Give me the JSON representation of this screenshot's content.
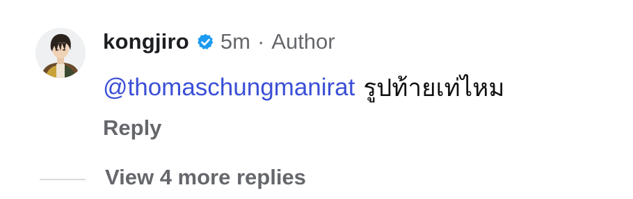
{
  "comment": {
    "username": "kongjiro",
    "verified_icon": "verified-badge-icon",
    "time": "5m",
    "separator": "·",
    "role": "Author",
    "mention": "@thomaschungmanirat",
    "text": "รูปท้ายเท่ไหม",
    "reply_label": "Reply"
  },
  "replies": {
    "view_more_label": "View 4 more replies"
  },
  "colors": {
    "mention": "#3b4fd6",
    "secondary_text": "#65676b",
    "verified": "#1d9bf0",
    "divider": "#d8dadf"
  }
}
